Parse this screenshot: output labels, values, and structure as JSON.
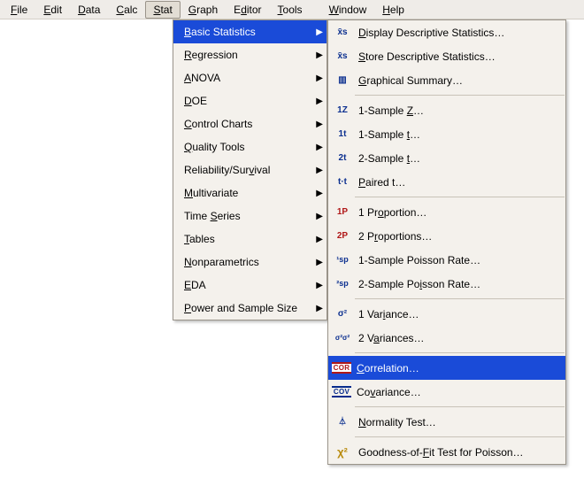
{
  "menubar": {
    "file": {
      "pre": "",
      "u": "F",
      "post": "ile"
    },
    "edit": {
      "pre": "",
      "u": "E",
      "post": "dit"
    },
    "data": {
      "pre": "",
      "u": "D",
      "post": "ata"
    },
    "calc": {
      "pre": "",
      "u": "C",
      "post": "alc"
    },
    "stat": {
      "pre": "",
      "u": "S",
      "post": "tat"
    },
    "graph": {
      "pre": "",
      "u": "G",
      "post": "raph"
    },
    "editor": {
      "pre": "E",
      "u": "d",
      "post": "itor"
    },
    "tools": {
      "pre": "",
      "u": "T",
      "post": "ools"
    },
    "window": {
      "pre": "",
      "u": "W",
      "post": "indow"
    },
    "help": {
      "pre": "",
      "u": "H",
      "post": "elp"
    }
  },
  "stat_menu": {
    "basic": {
      "pre": "",
      "u": "B",
      "post": "asic Statistics"
    },
    "regression": {
      "pre": "",
      "u": "R",
      "post": "egression"
    },
    "anova": {
      "pre": "",
      "u": "A",
      "post": "NOVA"
    },
    "doe": {
      "pre": "",
      "u": "D",
      "post": "OE"
    },
    "control": {
      "pre": "",
      "u": "C",
      "post": "ontrol Charts"
    },
    "quality": {
      "pre": "",
      "u": "Q",
      "post": "uality Tools"
    },
    "reliab": {
      "pre": "Reliability/Sur",
      "u": "v",
      "post": "ival"
    },
    "multi": {
      "pre": "",
      "u": "M",
      "post": "ultivariate"
    },
    "time": {
      "pre": "Time ",
      "u": "S",
      "post": "eries"
    },
    "tables": {
      "pre": "",
      "u": "T",
      "post": "ables"
    },
    "nonparam": {
      "pre": "",
      "u": "N",
      "post": "onparametrics"
    },
    "eda": {
      "pre": "",
      "u": "E",
      "post": "DA"
    },
    "power": {
      "pre": "",
      "u": "P",
      "post": "ower and Sample Size"
    }
  },
  "basic_menu": {
    "ddesc": {
      "icon": "x̄s",
      "pre": "",
      "u": "D",
      "post": "isplay Descriptive Statistics…"
    },
    "sdesc": {
      "icon": "x̄s",
      "pre": "",
      "u": "S",
      "post": "tore Descriptive Statistics…"
    },
    "gsum": {
      "icon": "▥",
      "pre": "",
      "u": "G",
      "post": "raphical Summary…"
    },
    "z1": {
      "icon": "1Z",
      "pre": "1-Sample ",
      "u": "Z",
      "post": "…"
    },
    "t1": {
      "icon": "1t",
      "pre": "1-Sample ",
      "u": "t",
      "post": "…"
    },
    "t2": {
      "icon": "2t",
      "pre": "2-Sample ",
      "u": "t",
      "post": "…"
    },
    "pt": {
      "icon": "t·t",
      "pre": "",
      "u": "P",
      "post": "aired t…"
    },
    "p1": {
      "icon": "1P",
      "pre": "1 Pr",
      "u": "o",
      "post": "portion…"
    },
    "p2": {
      "icon": "2P",
      "pre": "2 P",
      "u": "r",
      "post": "oportions…"
    },
    "pois1": {
      "icon": "¹sp",
      "pre": "1-Sample Poisson Rate…",
      "u": "",
      "post": ""
    },
    "pois2": {
      "icon": "²sp",
      "pre": "2-Sample Po",
      "u": "i",
      "post": "sson Rate…"
    },
    "var1": {
      "icon": "σ²",
      "pre": "1 Var",
      "u": "i",
      "post": "ance…"
    },
    "var2": {
      "icon": "σ²σ²",
      "pre": "2 V",
      "u": "a",
      "post": "riances…"
    },
    "corr": {
      "icon": "COR",
      "pre": "",
      "u": "C",
      "post": "orrelation…"
    },
    "covar": {
      "icon": "COV",
      "pre": "Co",
      "u": "v",
      "post": "ariance…"
    },
    "norm": {
      "icon": "⏃",
      "pre": "",
      "u": "N",
      "post": "ormality Test…"
    },
    "gof": {
      "icon": "χ²",
      "pre": "Goodness-of-",
      "u": "F",
      "post": "it Test for Poisson…"
    }
  },
  "arrow": "▶"
}
